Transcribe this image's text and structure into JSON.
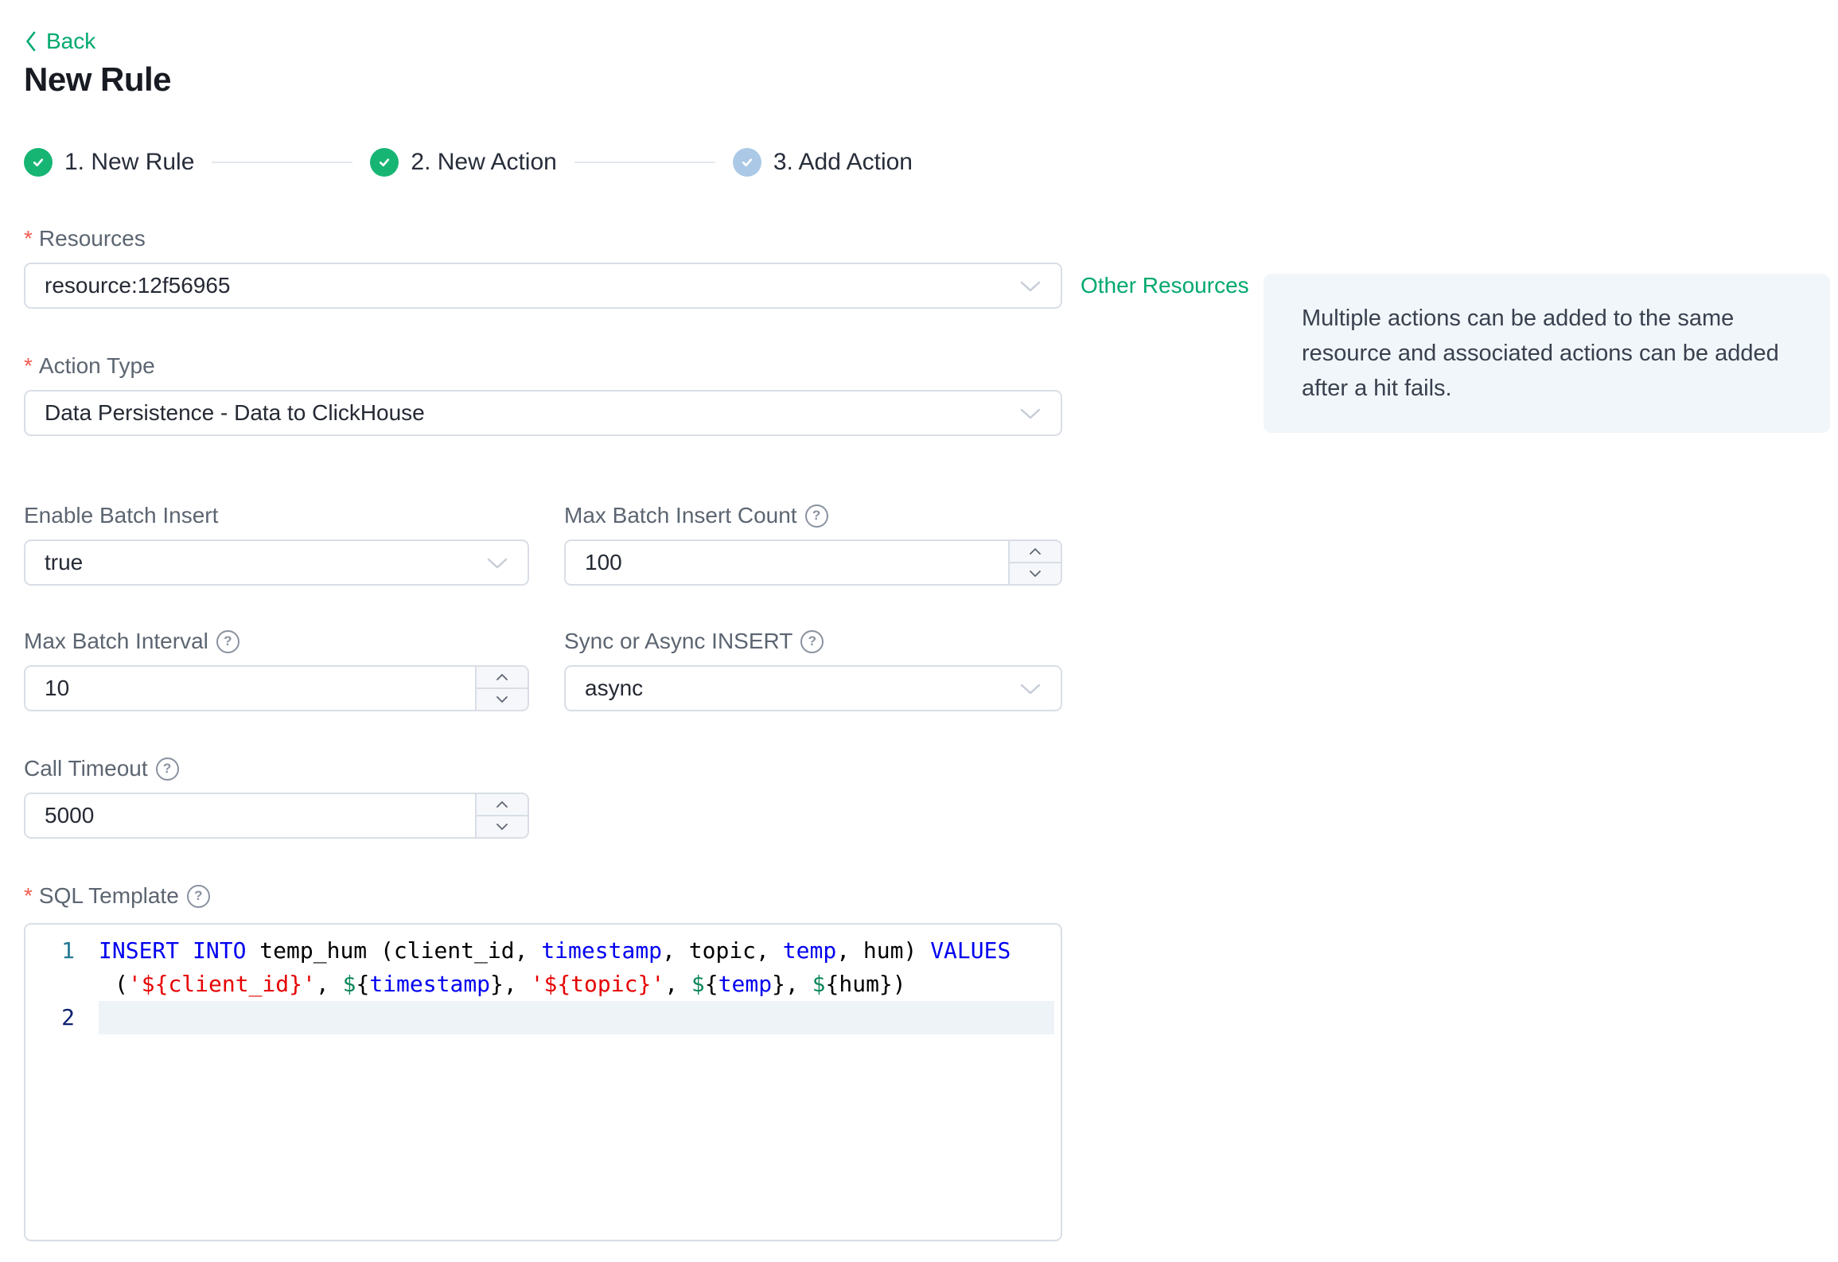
{
  "colors": {
    "green": "#00a96e",
    "step_done": "#17b574",
    "step_pending": "#abc9e6",
    "step_line": "#e3e8ef",
    "label": "#5c6571",
    "asterisk": "#f25a50",
    "border": "#d9dee6",
    "stepper_bg": "#f5f7fa",
    "help": "#8a92a0",
    "chevron": "#c6ccd6",
    "info_bg": "#f1f6fa",
    "info_text": "#39404e",
    "editor_active_bg": "#eef3f8",
    "ln": "#237893",
    "ln_active": "#0b216f",
    "kw": "#0000f0",
    "str": "#e60000",
    "dollar": "#098658",
    "plain": "#000000"
  },
  "header": {
    "back_label": "Back",
    "title": "New Rule"
  },
  "steps": [
    {
      "label": "1. New Rule",
      "state": "done"
    },
    {
      "label": "2. New Action",
      "state": "done"
    },
    {
      "label": "3. Add Action",
      "state": "pending"
    }
  ],
  "fields": {
    "resources": {
      "label": "Resources",
      "value": "resource:12f56965"
    },
    "other_resources_link": "Other Resources",
    "info_note": "Multiple actions can be added to the same resource and associated actions can be added after a hit fails.",
    "action_type": {
      "label": "Action Type",
      "value": "Data Persistence - Data to ClickHouse"
    },
    "enable_batch": {
      "label": "Enable Batch Insert",
      "value": "true"
    },
    "max_batch_count": {
      "label": "Max Batch Insert Count",
      "value": "100"
    },
    "max_batch_interval": {
      "label": "Max Batch Interval",
      "value": "10"
    },
    "sync_async": {
      "label": "Sync or Async INSERT",
      "value": "async"
    },
    "call_timeout": {
      "label": "Call Timeout",
      "value": "5000"
    },
    "sql_template": {
      "label": "SQL Template"
    }
  },
  "sql_editor": {
    "rows": [
      {
        "gutter": "1",
        "gutter_active": false,
        "active": false,
        "indent": 0,
        "tokens": [
          {
            "c": "kw",
            "t": "INSERT INTO "
          },
          {
            "c": "plain",
            "t": "temp_hum (client_id, "
          },
          {
            "c": "kw",
            "t": "timestamp"
          },
          {
            "c": "plain",
            "t": ", topic, "
          },
          {
            "c": "kw",
            "t": "temp"
          },
          {
            "c": "plain",
            "t": ", hum) "
          },
          {
            "c": "kw",
            "t": "VALUES"
          }
        ]
      },
      {
        "gutter": "",
        "gutter_active": false,
        "active": false,
        "indent": 20,
        "tokens": [
          {
            "c": "plain",
            "t": "("
          },
          {
            "c": "str",
            "t": "'${client_id}'"
          },
          {
            "c": "plain",
            "t": ", "
          },
          {
            "c": "dollar",
            "t": "$"
          },
          {
            "c": "plain",
            "t": "{"
          },
          {
            "c": "kw",
            "t": "timestamp"
          },
          {
            "c": "plain",
            "t": "}, "
          },
          {
            "c": "str",
            "t": "'${topic}'"
          },
          {
            "c": "plain",
            "t": ", "
          },
          {
            "c": "dollar",
            "t": "$"
          },
          {
            "c": "plain",
            "t": "{"
          },
          {
            "c": "kw",
            "t": "temp"
          },
          {
            "c": "plain",
            "t": "}, "
          },
          {
            "c": "dollar",
            "t": "$"
          },
          {
            "c": "plain",
            "t": "{hum})"
          }
        ]
      },
      {
        "gutter": "2",
        "gutter_active": true,
        "active": true,
        "indent": 0,
        "tokens": []
      }
    ]
  }
}
